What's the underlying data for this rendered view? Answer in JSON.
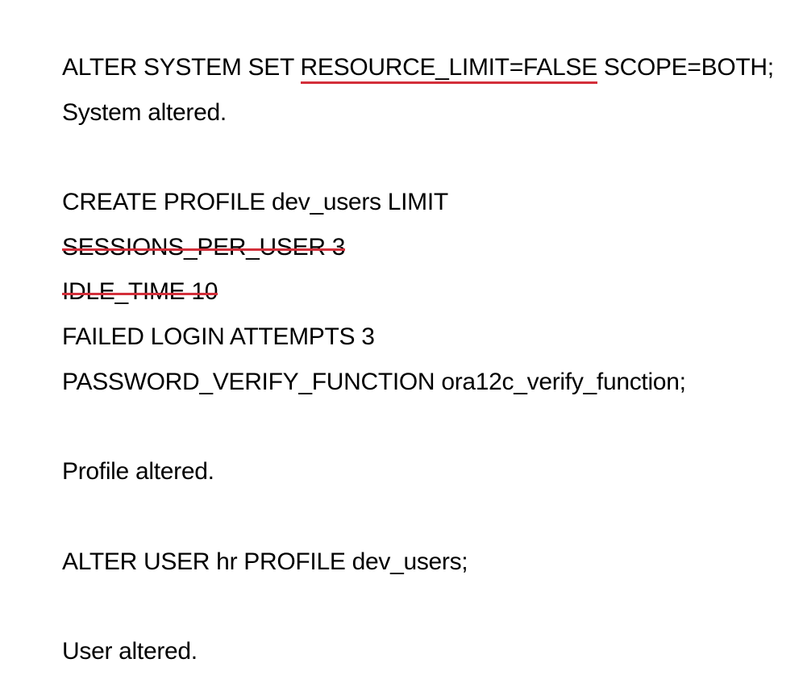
{
  "document": {
    "line1": {
      "before": "ALTER SYSTEM SET ",
      "underlined": "RESOURCE_LIMIT=FALSE",
      "after": " SCOPE=BOTH;"
    },
    "line2": "System altered.",
    "line4": "CREATE PROFILE dev_users LIMIT",
    "line5_struck": "SESSIONS_PER_USER 3",
    "line6_struck": "IDLE_TIME 10",
    "line7": "FAILED LOGIN ATTEMPTS 3",
    "line8": "PASSWORD_VERIFY_FUNCTION ora12c_verify_function;",
    "line10": "Profile altered.",
    "line12": "ALTER USER hr PROFILE dev_users;",
    "line14": "User altered."
  },
  "colors": {
    "annotation_red": "#d32f3a",
    "text": "#000000",
    "background": "#ffffff"
  }
}
